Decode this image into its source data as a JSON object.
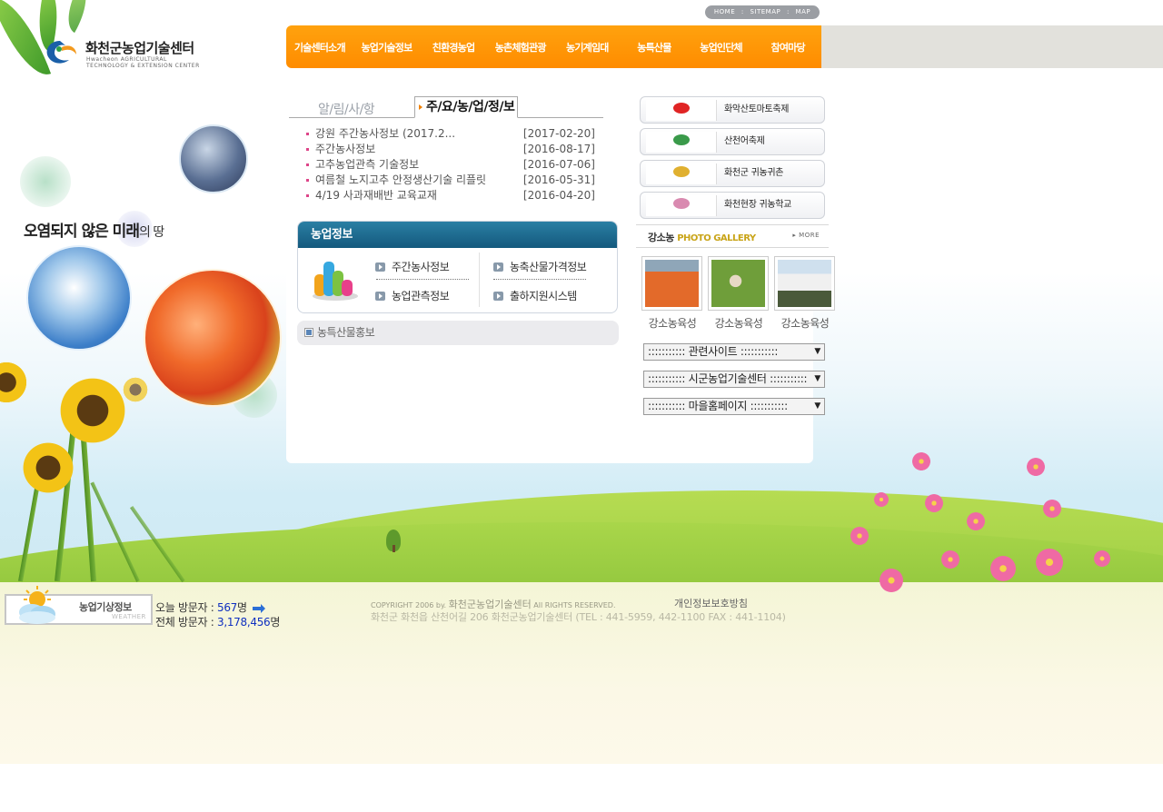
{
  "header": {
    "logo_title": "화천군농업기술센터",
    "logo_en_line1": "Hwacheon AGRICULTURAL",
    "logo_en_line2": "TECHNOLOGY & EXTENSION CENTER",
    "util_links": [
      "HOME",
      "SITEMAP",
      "MAP"
    ],
    "util_sep": ":",
    "nav": [
      "기술센터소개",
      "농업기술정보",
      "친환경농업",
      "농촌체험관광",
      "농기계임대",
      "농특산물",
      "농업인단체",
      "참여마당"
    ],
    "accent_color": "#ff9600"
  },
  "left": {
    "slogan_main": "오염되지 않은 미래",
    "slogan_tail": "의 땅"
  },
  "notice": {
    "tab_inactive": "알/림/사/항",
    "tab_active": "주/요/농/업/정/보",
    "items": [
      {
        "title": "강원 주간농사정보 (2017.2...",
        "date": "[2017-02-20]"
      },
      {
        "title": "주간농사정보",
        "date": "[2016-08-17]"
      },
      {
        "title": "고추농업관측 기술정보",
        "date": "[2016-07-06]"
      },
      {
        "title": "여름철 노지고추 안정생산기술 리플릿",
        "date": "[2016-05-31]"
      },
      {
        "title": "4/19 사과재배반 교육교재",
        "date": "[2016-04-20]"
      }
    ]
  },
  "agri_info": {
    "title": "농업정보",
    "links": [
      "주간농사정보",
      "농축산물가격정보",
      "농업관측정보",
      "출하지원시스템"
    ]
  },
  "promo": {
    "label": "농특산물홍보"
  },
  "festivals": [
    {
      "label": "화악산토마토축제",
      "mark": "tomato-logo-icon"
    },
    {
      "label": "산천어축제",
      "mark": "fish-logo-icon"
    },
    {
      "label": "화천군 귀농귀촌",
      "mark": "farm-logo-icon"
    },
    {
      "label": "화천현장 귀농학교",
      "mark": "school-logo-icon"
    }
  ],
  "gallery": {
    "title_ko": "강소농",
    "title_en": "PHOTO GALLERY",
    "more": "MORE",
    "captions": [
      "강소농육성",
      "강소농육성",
      "강소농육성"
    ]
  },
  "selects": [
    "::::::::::: 관련사이트 :::::::::::",
    "::::::::::: 시군농업기술센터 :::::::::::",
    "::::::::::: 마을홈페이지 :::::::::::"
  ],
  "footer": {
    "weather_title": "농업기상정보",
    "weather_en": "WEATHER",
    "today_label": "오늘 방문자 : ",
    "today_count": "567",
    "total_label": "전체 방문자 : ",
    "total_count": "3,178,456",
    "count_unit": "명",
    "copyright_pre": "COPYRIGHT 2006 by.",
    "copyright_org": "화천군농업기술센터",
    "copyright_post": "All RIGHTS RESERVED.",
    "privacy": "개인정보보호방침",
    "address": "화천군 화천읍 산천어길 206 화천군농업기술센터 (TEL : 441-5959, 442-1100 FAX : 441-1104)"
  }
}
